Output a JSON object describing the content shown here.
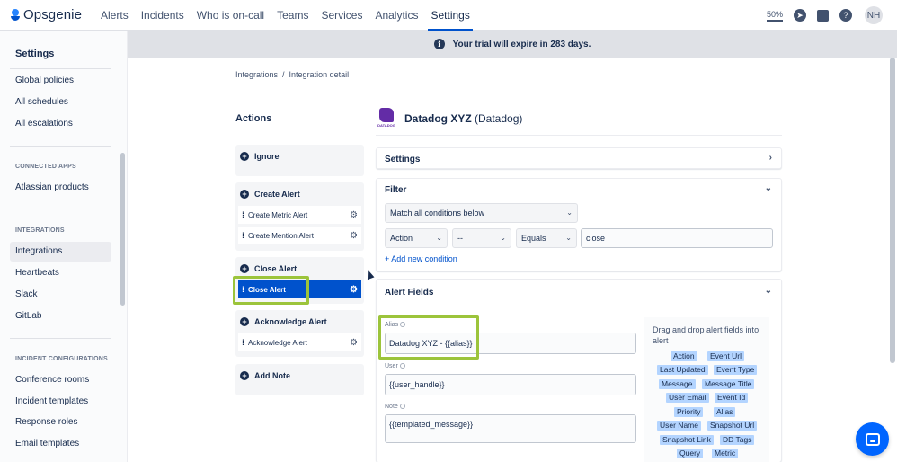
{
  "nav": {
    "brand": "Opsgenie",
    "items": [
      "Alerts",
      "Incidents",
      "Who is on-call",
      "Teams",
      "Services",
      "Analytics",
      "Settings"
    ],
    "zoom": "50%",
    "avatar": "NH"
  },
  "banner": {
    "text": "Your trial will expire in 283 days."
  },
  "sidebar": {
    "title": "Settings",
    "items": [
      "Global policies",
      "All schedules",
      "All escalations"
    ],
    "connected_header": "CONNECTED APPS",
    "connected_items": [
      "Atlassian products"
    ],
    "integrations_header": "INTEGRATIONS",
    "integrations_items": [
      "Integrations",
      "Heartbeats",
      "Slack",
      "GitLab"
    ],
    "incident_header": "INCIDENT CONFIGURATIONS",
    "incident_items": [
      "Conference rooms",
      "Incident templates",
      "Response roles",
      "Email templates"
    ]
  },
  "breadcrumb": {
    "first": "Integrations",
    "sep": "/",
    "second": "Integration detail"
  },
  "actions": {
    "title": "Actions",
    "ignore": "Ignore",
    "create_alert": "Create Alert",
    "create_metric_alert": "Create Metric Alert",
    "create_mention_alert": "Create Mention Alert",
    "close_alert_group": "Close Alert",
    "close_alert": "Close Alert",
    "acknowledge_alert_group": "Acknowledge Alert",
    "acknowledge_alert": "Acknowledge Alert",
    "add_note": "Add Note"
  },
  "integration": {
    "name": "Datadog XYZ",
    "type": "(Datadog)",
    "logo_text": "DATADOG"
  },
  "settings_panel": {
    "title": "Settings"
  },
  "filter_panel": {
    "title": "Filter",
    "match": "Match all conditions below",
    "field": "Action",
    "negate": "--",
    "operator": "Equals",
    "value": "close",
    "add_condition": "+ Add new condition"
  },
  "alert_fields": {
    "title": "Alert Fields",
    "alias_label": "Alias",
    "alias_value": "Datadog XYZ - {{alias}}",
    "user_label": "User",
    "user_value": "{{user_handle}}",
    "note_label": "Note",
    "note_value": "{{templated_message}}",
    "dnd_hint": "Drag and drop alert fields into alert",
    "chips": [
      "Action",
      "Event Url",
      "Last Updated",
      "Event Type",
      "Message",
      "Message Title",
      "User Email",
      "Event Id",
      "Priority",
      "Alias",
      "User Name",
      "Snapshot Url",
      "Snapshot Link",
      "DD Tags",
      "Query",
      "Metric"
    ]
  },
  "colors": {
    "accent": "#0052CC",
    "highlight": "#9CC43B",
    "chip": "#B3D4FF",
    "datadog": "#632CA6"
  }
}
